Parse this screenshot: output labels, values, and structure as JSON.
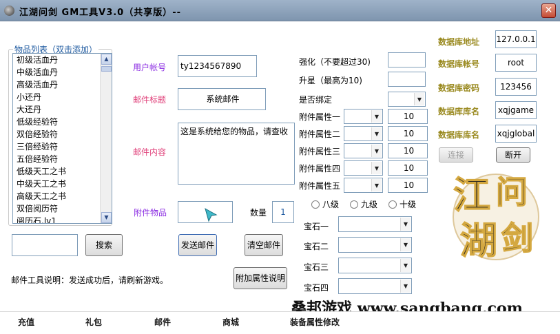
{
  "window": {
    "title": "江湖问剑 GM工具V3.0（共享版）--",
    "close_glyph": "✕"
  },
  "item_list": {
    "legend": "物品列表（双击添加）",
    "items": [
      "初级活血丹",
      "中级活血丹",
      "高级活血丹",
      "小还丹",
      "大还丹",
      "低级经验符",
      "双倍经验符",
      "三倍经验符",
      "五倍经验符",
      "低级天工之书",
      "中级天工之书",
      "高级天工之书",
      "双倍阅历符",
      "阅历石.lv1"
    ]
  },
  "search": {
    "input_value": "",
    "button_label": "搜索"
  },
  "mail": {
    "account_label": "用户帐号",
    "account_value": "ty1234567890",
    "subject_label": "邮件标题",
    "subject_value": "系统邮件",
    "content_label": "邮件内容",
    "content_value": "这是系统给您的物品，请查收",
    "attachment_label": "附件物品",
    "attachment_value": "",
    "quantity_label": "数量",
    "quantity_value": "1",
    "send_button": "发送邮件",
    "clear_button": "清空邮件"
  },
  "help_text": "邮件工具说明：发送成功后，请刷新游戏。",
  "extra_attr_button": "附加属性说明",
  "enhance": {
    "strengthen_label": "强化（不要超过30)",
    "strengthen_value": "",
    "star_label": "升星（最高为10)",
    "star_value": "",
    "bind_label": "是否绑定",
    "attrs": [
      {
        "label": "附件属性一",
        "value": "10"
      },
      {
        "label": "附件属性二",
        "value": "10"
      },
      {
        "label": "附件属性三",
        "value": "10"
      },
      {
        "label": "附件属性四",
        "value": "10"
      },
      {
        "label": "附件属性五",
        "value": "10"
      }
    ],
    "grades": [
      "八级",
      "九级",
      "十级"
    ],
    "gems": [
      "宝石一",
      "宝石二",
      "宝石三",
      "宝石四"
    ]
  },
  "database": {
    "address_label": "数据库地址",
    "address_value": "127.0.0.1",
    "account_label": "数据库帐号",
    "account_value": "root",
    "password_label": "数据库密码",
    "password_value": "123456",
    "name_label": "数据库库名",
    "name_value": "xqjgame",
    "name2_label": "数据库库名",
    "name2_value": "xqjglobal",
    "connect_button": "连接",
    "disconnect_button": "断开"
  },
  "logo": {
    "chars": [
      "江",
      "问",
      "湖",
      "剑"
    ]
  },
  "watermark": "桑邦游戏 www.sangbang.com",
  "tabs": [
    "充值",
    "礼包",
    "邮件",
    "商城",
    "装备属性修改"
  ],
  "colors": {
    "title_bar": "#8fa5be",
    "purple_label": "#8a2be2",
    "pink_label": "#e0407a",
    "db_label": "#9a8a20",
    "legend": "#1e5aa0"
  },
  "icons": {
    "dropdown": "▼",
    "scroll_up": "▲",
    "scroll_down": "▼"
  }
}
